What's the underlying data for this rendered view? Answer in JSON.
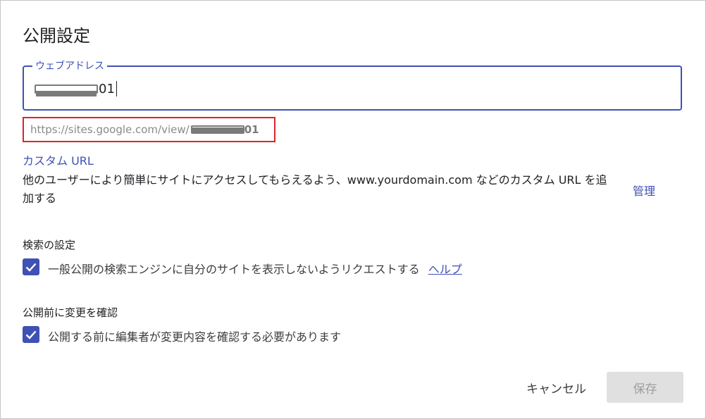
{
  "dialog": {
    "title": "公開設定",
    "web_address": {
      "label": "ウェブアドレス",
      "value_suffix": "01"
    },
    "url_preview": {
      "prefix": "https://sites.google.com/view/",
      "suffix": "01"
    },
    "custom_url": {
      "heading": "カスタム URL",
      "description": "他のユーザーにより簡単にサイトにアクセスしてもらえるよう、www.yourdomain.com などのカスタム URL を追加する",
      "manage_label": "管理"
    },
    "search_settings": {
      "heading": "検索の設定",
      "checkbox_label": "一般公開の検索エンジンに自分のサイトを表示しないようリクエストする",
      "checked": true,
      "help_label": "ヘルプ"
    },
    "review_settings": {
      "heading": "公開前に変更を確認",
      "checkbox_label": "公開する前に編集者が変更内容を確認する必要があります",
      "checked": true
    },
    "buttons": {
      "cancel_label": "キャンセル",
      "save_label": "保存"
    }
  },
  "colors": {
    "accent": "#3f51b5",
    "highlight_box": "#e0212b",
    "disabled_button_bg": "#e0e0e0"
  },
  "icons": {
    "checkbox": "checkmark-icon"
  }
}
